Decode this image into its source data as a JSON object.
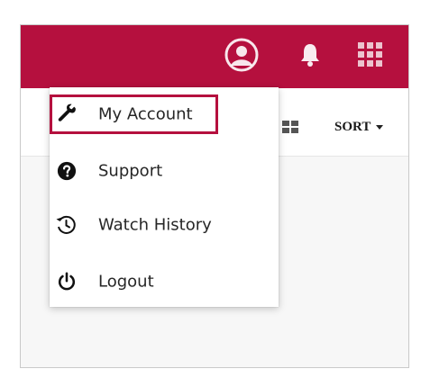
{
  "header": {
    "icons": [
      "account-circle-icon",
      "bell-icon",
      "apps-grid-icon"
    ],
    "accent_color": "#b5103e"
  },
  "toolbar": {
    "view_icon": "grid-view-icon",
    "sort_label": "SORT"
  },
  "menu": {
    "items": [
      {
        "label": "My Account",
        "icon": "wrench-icon",
        "highlighted": true
      },
      {
        "label": "Support",
        "icon": "help-icon"
      },
      {
        "label": "Watch History",
        "icon": "history-icon"
      },
      {
        "label": "Logout",
        "icon": "power-icon"
      }
    ]
  }
}
